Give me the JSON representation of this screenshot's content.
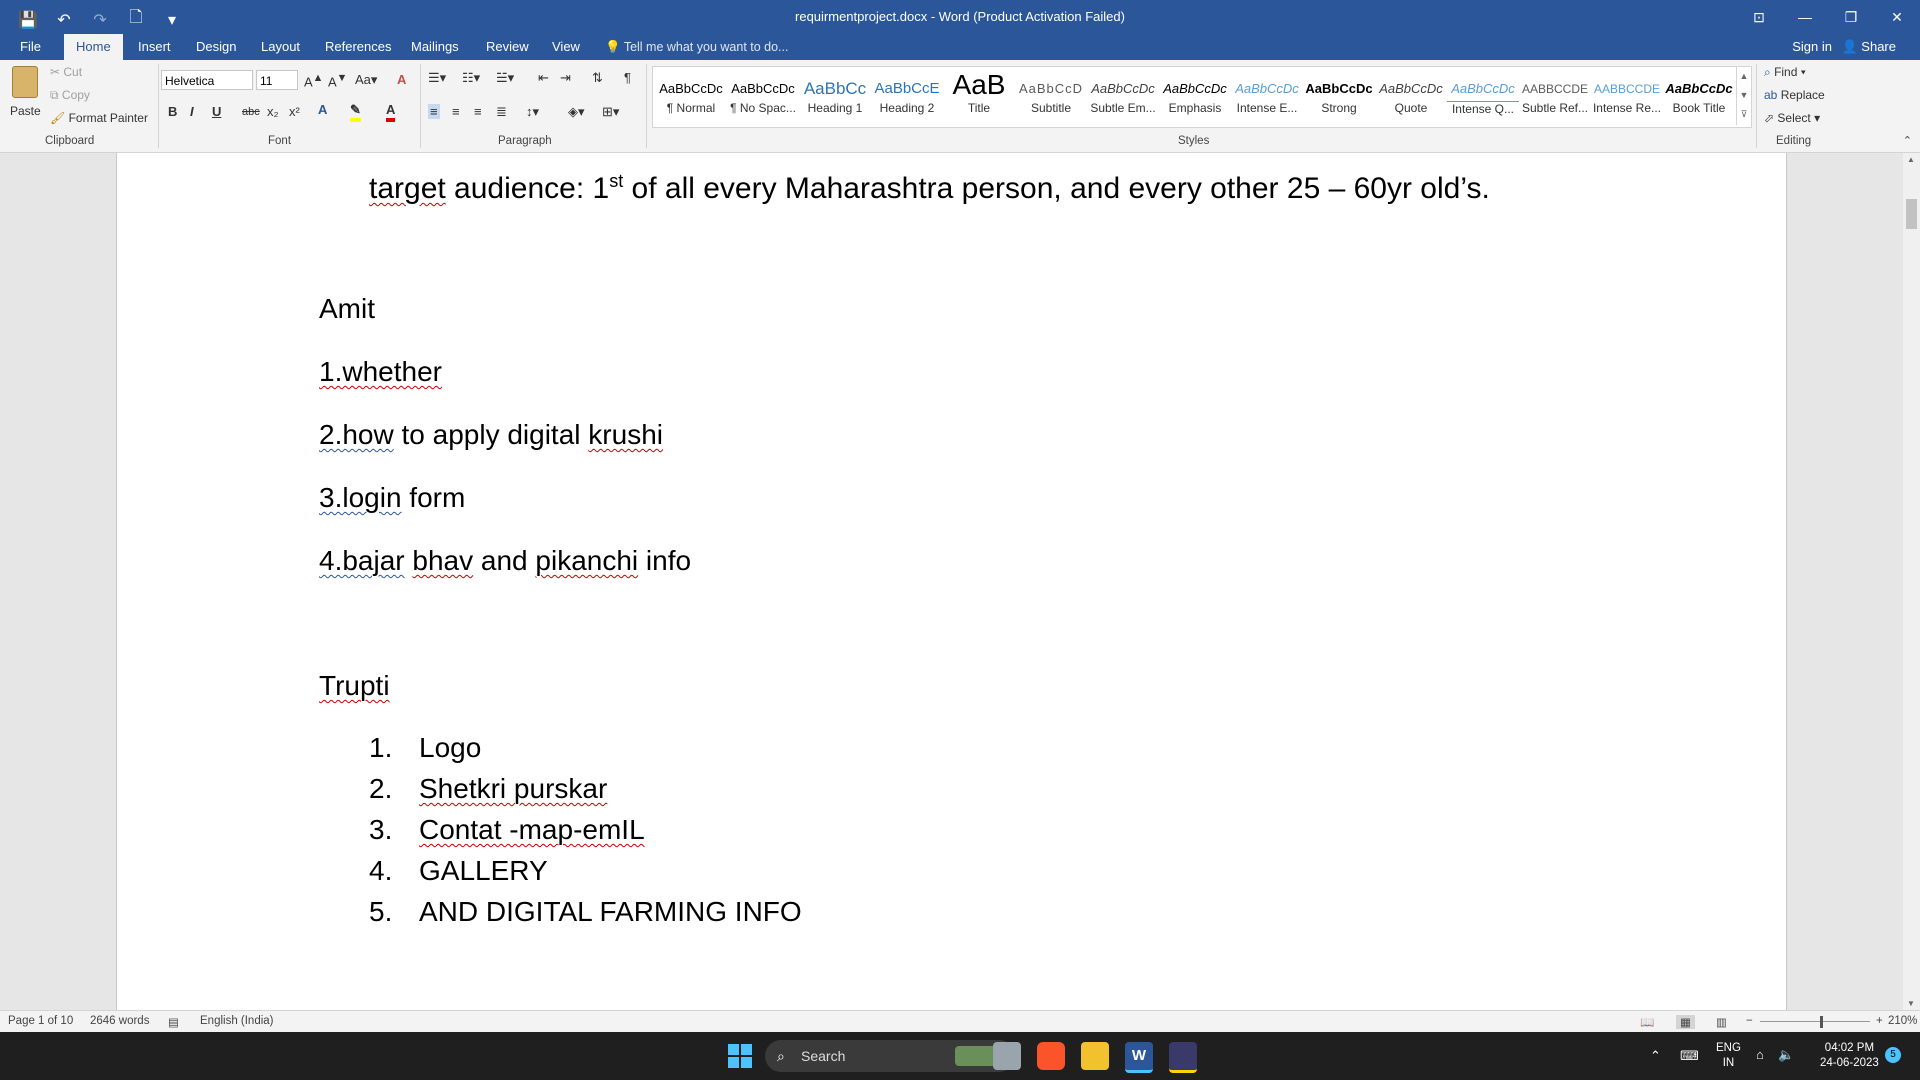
{
  "window": {
    "title": "requirmentproject.docx - Word (Product Activation Failed)",
    "controls": [
      "⊡",
      "—",
      "❐",
      "✕"
    ]
  },
  "qat": {
    "save": "💾",
    "undo": "↶",
    "redo": "↷",
    "new": "🗋",
    "customize": "▾"
  },
  "tabs": [
    "File",
    "Home",
    "Insert",
    "Design",
    "Layout",
    "References",
    "Mailings",
    "Review",
    "View"
  ],
  "active_tab": "Home",
  "tell_me": "Tell me what you want to do...",
  "account": {
    "signin": "Sign in",
    "share": "Share"
  },
  "clipboard": {
    "paste": "Paste",
    "cut": "Cut",
    "copy": "Copy",
    "format_painter": "Format Painter",
    "label": "Clipboard"
  },
  "font": {
    "name": "Helvetica",
    "size": "11",
    "label": "Font"
  },
  "paragraph": {
    "label": "Paragraph"
  },
  "styles": {
    "label": "Styles",
    "items": [
      {
        "preview": "AaBbCcDc",
        "name": "¶ Normal"
      },
      {
        "preview": "AaBbCcDc",
        "name": "¶ No Spac..."
      },
      {
        "preview": "AaBbCc",
        "name": "Heading 1"
      },
      {
        "preview": "AaBbCcE",
        "name": "Heading 2"
      },
      {
        "preview": "AaB",
        "name": "Title"
      },
      {
        "preview": "AaBbCcD",
        "name": "Subtitle"
      },
      {
        "preview": "AaBbCcDc",
        "name": "Subtle Em..."
      },
      {
        "preview": "AaBbCcDc",
        "name": "Emphasis"
      },
      {
        "preview": "AaBbCcDc",
        "name": "Intense E..."
      },
      {
        "preview": "AaBbCcDc",
        "name": "Strong"
      },
      {
        "preview": "AaBbCcDc",
        "name": "Quote"
      },
      {
        "preview": "AaBbCcDc",
        "name": "Intense Q..."
      },
      {
        "preview": "AABBCCDE",
        "name": "Subtle Ref..."
      },
      {
        "preview": "AABBCCDE",
        "name": "Intense Re..."
      },
      {
        "preview": "AaBbCcDc",
        "name": "Book Title"
      }
    ]
  },
  "editing": {
    "find": "Find",
    "replace": "Replace",
    "select": "Select",
    "label": "Editing"
  },
  "document": {
    "target_line": {
      "a": "target",
      "b": " audience: 1",
      "sup": "st",
      "c": " of all every Maharashtra person, and every other 25 – 60yr old’s."
    },
    "amit": "Amit",
    "amit_items": [
      [
        "1.whether",
        ""
      ],
      [
        "2.how",
        " to apply digital ",
        "krushi"
      ],
      [
        "3.login",
        " form"
      ],
      [
        "4.bajar",
        " ",
        "bhav",
        " and ",
        "pikanchi",
        " info"
      ]
    ],
    "trupti": "Trupti",
    "trupti_list": [
      {
        "num": "1.",
        "text": "Logo"
      },
      {
        "num": "2.",
        "text": "Shetkri purskar"
      },
      {
        "num": "3.",
        "text": "Contat -map-emIL"
      },
      {
        "num": "4.",
        "text": "GALLERY"
      },
      {
        "num": "5.",
        "text": "AND DIGITAL FARMING INFO"
      }
    ]
  },
  "status": {
    "page": "Page 1 of 10",
    "words": "2646 words",
    "language": "English (India)",
    "zoom": "210%"
  },
  "taskbar": {
    "search": "Search",
    "lang_top": "ENG",
    "lang_bottom": "IN",
    "time": "04:02 PM",
    "date": "24-06-2023",
    "badge": "5"
  },
  "colors": {
    "word_blue": "#2b579a",
    "taskbar": "#1f1f1f"
  }
}
